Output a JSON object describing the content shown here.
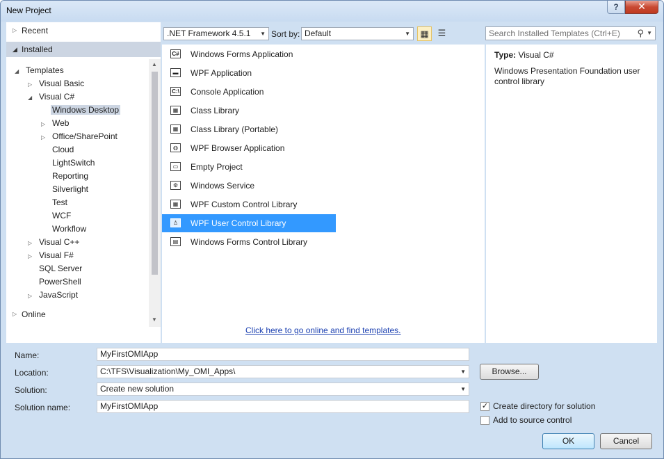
{
  "window": {
    "title": "New Project",
    "help_glyph": "?",
    "close_glyph": "✕"
  },
  "nav": {
    "recent": "Recent",
    "installed": "Installed",
    "online": "Online",
    "tree": [
      {
        "label": "Templates",
        "arrow": "◢"
      },
      {
        "label": "Visual Basic",
        "arrow": "▷"
      },
      {
        "label": "Visual C#",
        "arrow": "◢"
      },
      {
        "label": "Windows Desktop",
        "arrow": ""
      },
      {
        "label": "Web",
        "arrow": "▷"
      },
      {
        "label": "Office/SharePoint",
        "arrow": "▷"
      },
      {
        "label": "Cloud",
        "arrow": ""
      },
      {
        "label": "LightSwitch",
        "arrow": ""
      },
      {
        "label": "Reporting",
        "arrow": ""
      },
      {
        "label": "Silverlight",
        "arrow": ""
      },
      {
        "label": "Test",
        "arrow": ""
      },
      {
        "label": "WCF",
        "arrow": ""
      },
      {
        "label": "Workflow",
        "arrow": ""
      },
      {
        "label": "Visual C++",
        "arrow": "▷"
      },
      {
        "label": "Visual F#",
        "arrow": "▷"
      },
      {
        "label": "SQL Server",
        "arrow": ""
      },
      {
        "label": "PowerShell",
        "arrow": ""
      },
      {
        "label": "JavaScript",
        "arrow": "▷"
      }
    ]
  },
  "toolbar": {
    "framework": ".NET Framework 4.5.1",
    "sort_label": "Sort by:",
    "sort_value": "Default",
    "search_placeholder": "Search Installed Templates (Ctrl+E)"
  },
  "templates": [
    {
      "name": "Windows Forms Application",
      "icon": "C#"
    },
    {
      "name": "WPF Application",
      "icon": "▬"
    },
    {
      "name": "Console Application",
      "icon": "C:\\"
    },
    {
      "name": "Class Library",
      "icon": "▦"
    },
    {
      "name": "Class Library (Portable)",
      "icon": "▦"
    },
    {
      "name": "WPF Browser Application",
      "icon": "◍"
    },
    {
      "name": "Empty Project",
      "icon": "▭"
    },
    {
      "name": "Windows Service",
      "icon": "⚙"
    },
    {
      "name": "WPF Custom Control Library",
      "icon": "▦"
    },
    {
      "name": "WPF User Control Library",
      "icon": "♙"
    },
    {
      "name": "Windows Forms Control Library",
      "icon": "▤"
    }
  ],
  "online_link": "Click here to go online and find templates.",
  "details": {
    "type_label": "Type:",
    "type_value": "Visual C#",
    "description": "Windows Presentation Foundation user control library"
  },
  "form": {
    "name_label": "Name:",
    "name_value": "MyFirstOMIApp",
    "location_label": "Location:",
    "location_value": "C:\\TFS\\Visualization\\My_OMI_Apps\\",
    "solution_label": "Solution:",
    "solution_value": "Create new solution",
    "solution_name_label": "Solution name:",
    "solution_name_value": "MyFirstOMIApp",
    "browse_label": "Browse...",
    "create_dir_label": "Create directory for solution",
    "source_control_label": "Add to source control",
    "ok_label": "OK",
    "cancel_label": "Cancel"
  }
}
